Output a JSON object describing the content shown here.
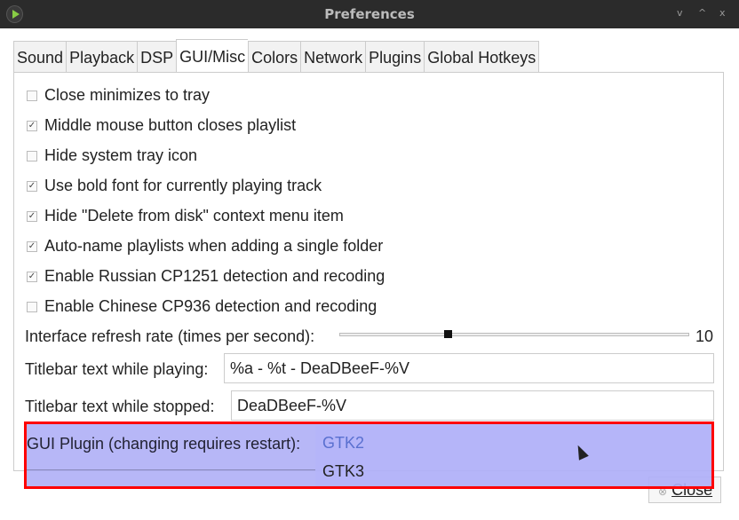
{
  "window": {
    "title": "Preferences",
    "controls": [
      "v",
      "^",
      "x"
    ]
  },
  "tabs": [
    {
      "label": "Sound"
    },
    {
      "label": "Playback"
    },
    {
      "label": "DSP"
    },
    {
      "label": "GUI/Misc",
      "active": true
    },
    {
      "label": "Colors"
    },
    {
      "label": "Network"
    },
    {
      "label": "Plugins"
    },
    {
      "label": "Global Hotkeys"
    }
  ],
  "checkboxes": [
    {
      "label": "Close minimizes to tray",
      "checked": false
    },
    {
      "label": "Middle mouse button closes playlist",
      "checked": true
    },
    {
      "label": "Hide system tray icon",
      "checked": false
    },
    {
      "label": "Use bold font for currently playing track",
      "checked": true
    },
    {
      "label": "Hide \"Delete from disk\" context menu item",
      "checked": true
    },
    {
      "label": "Auto-name playlists when adding a single folder",
      "checked": true
    },
    {
      "label": "Enable Russian CP1251 detection and recoding",
      "checked": true
    },
    {
      "label": "Enable Chinese CP936 detection and recoding",
      "checked": false
    }
  ],
  "refresh": {
    "label": "Interface refresh rate (times per second):",
    "value": "10",
    "min": 1,
    "max": 30
  },
  "titlebar_playing": {
    "label": "Titlebar text while playing:",
    "value": "%a - %t - DeaDBeeF-%V"
  },
  "titlebar_stopped": {
    "label": "Titlebar text while stopped:",
    "value": "DeaDBeeF-%V"
  },
  "gui_plugin": {
    "label": "GUI Plugin (changing requires restart):",
    "options": [
      "GTK2",
      "GTK3"
    ],
    "highlighted": "GTK2"
  },
  "close_label": "Close",
  "colors": {
    "highlight": "#ff0000",
    "selected_text": "#5a70d0"
  }
}
